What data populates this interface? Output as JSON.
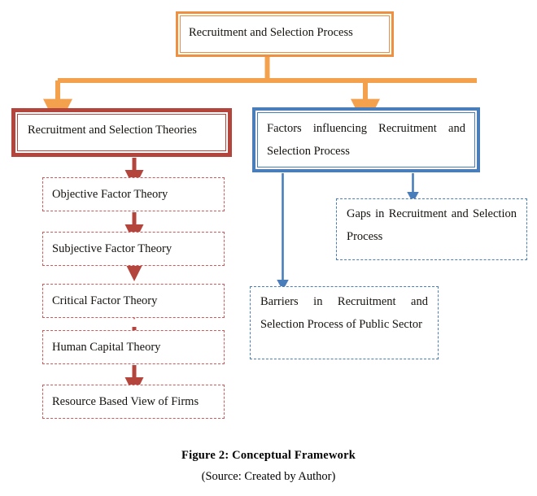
{
  "figure": {
    "root": {
      "label": "Recruitment and Selection Process"
    },
    "branch_left": {
      "label": "Recruitment and Selection Theories"
    },
    "branch_right": {
      "label": "Factors influencing Recruitment and Selection Process"
    },
    "theories": [
      {
        "label": "Objective Factor Theory"
      },
      {
        "label": "Subjective Factor Theory"
      },
      {
        "label": "Critical Factor Theory"
      },
      {
        "label": "Human Capital Theory"
      },
      {
        "label": "Resource Based View of Firms"
      }
    ],
    "factor_children": [
      {
        "label": "Gaps in Recruitment and Selection Process"
      },
      {
        "label": "Barriers in Recruitment and Selection Process of Public Sector"
      }
    ],
    "caption": {
      "title": "Figure 2: Conceptual Framework",
      "source": "(Source: Created by Author)"
    },
    "colors": {
      "orange": "#ED9042",
      "dark_red": "#B4453D",
      "dashed_red": "#CC5B5B",
      "blue": "#4A7EBB",
      "text": "#15120E",
      "background": "#FFFFFF"
    }
  }
}
